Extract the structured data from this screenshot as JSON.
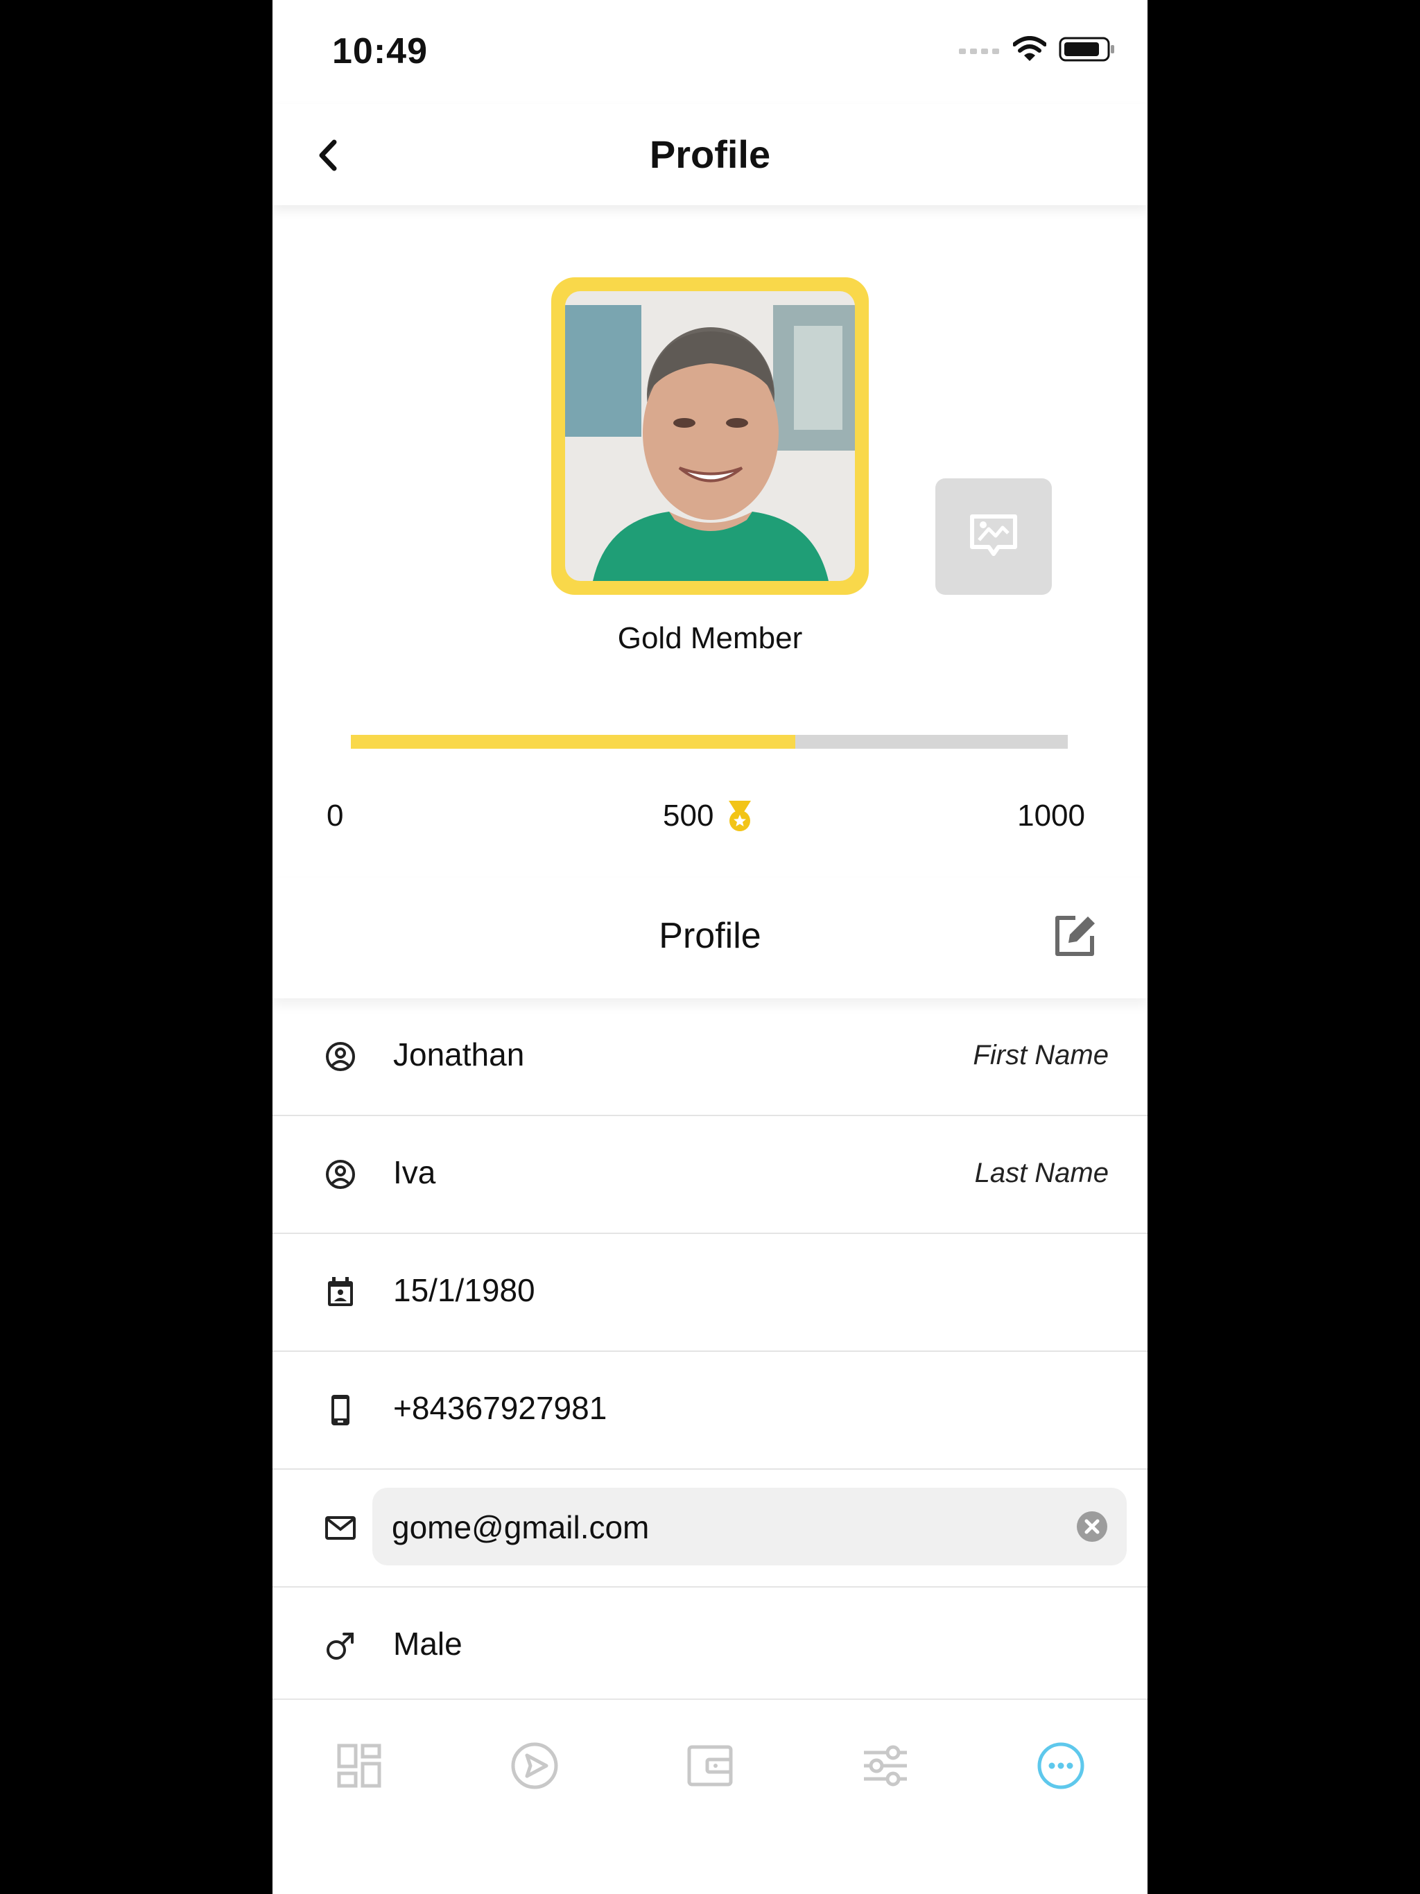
{
  "status_bar": {
    "time": "10:49"
  },
  "nav": {
    "title": "Profile"
  },
  "hero": {
    "member_label": "Gold Member",
    "progress": {
      "min": "0",
      "current": "500",
      "max": "1000",
      "fill_fraction": 0.62
    }
  },
  "section": {
    "title": "Profile"
  },
  "fields": {
    "first_name": {
      "value": "Jonathan",
      "hint": "First Name"
    },
    "last_name": {
      "value": "Iva",
      "hint": "Last Name"
    },
    "birthday": {
      "value": "15/1/1980"
    },
    "phone": {
      "value": "+84367927981"
    },
    "email": {
      "value": "gome@gmail.com"
    },
    "gender": {
      "value": "Male"
    }
  },
  "tabbar": {
    "tabs": [
      "dashboard-icon",
      "send-icon",
      "wallet-icon",
      "settings-sliders-icon",
      "more-icon"
    ],
    "active": "more-icon"
  },
  "colors": {
    "accent_gold": "#f9d84a",
    "active_tab": "#5ec8ec",
    "inactive_tab": "#c8c8c8"
  }
}
